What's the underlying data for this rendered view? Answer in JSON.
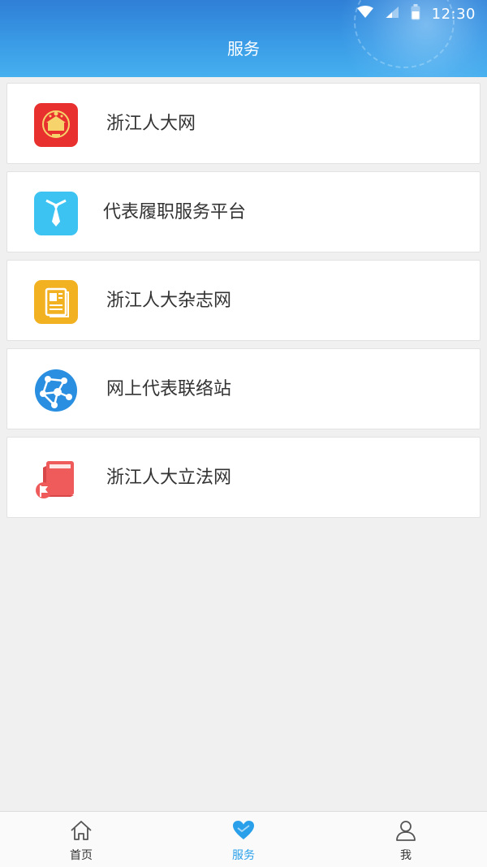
{
  "status_bar": {
    "time": "12:30"
  },
  "header": {
    "title": "服务"
  },
  "services": [
    {
      "label": "浙江人大网",
      "icon": "national-emblem-icon",
      "color": "#e8312f"
    },
    {
      "label": "代表履职服务平台",
      "icon": "tie-icon",
      "color": "#3cc3f2"
    },
    {
      "label": "浙江人大杂志网",
      "icon": "magazine-icon",
      "color": "#f2b120"
    },
    {
      "label": "网上代表联络站",
      "icon": "network-globe-icon",
      "color": "#2a8fe0"
    },
    {
      "label": "浙江人大立法网",
      "icon": "law-book-icon",
      "color": "#ef5a5a"
    }
  ],
  "tabbar": {
    "items": [
      {
        "label": "首页",
        "icon": "home-icon"
      },
      {
        "label": "服务",
        "icon": "heart-icon",
        "active": true
      },
      {
        "label": "我",
        "icon": "person-icon"
      }
    ]
  },
  "colors": {
    "accent": "#2aa0ea",
    "header_top": "#2f7fd6",
    "header_bottom": "#46b0ef"
  }
}
